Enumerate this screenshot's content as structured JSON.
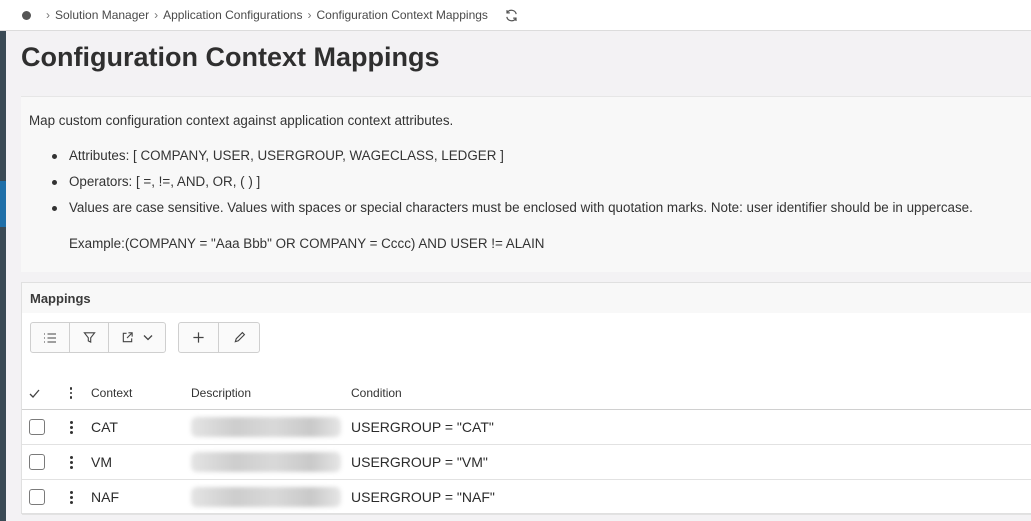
{
  "breadcrumb": {
    "items": [
      "Solution Manager",
      "Application Configurations",
      "Configuration Context Mappings"
    ]
  },
  "page": {
    "title": "Configuration Context Mappings"
  },
  "info": {
    "intro": "Map custom configuration context against application context attributes.",
    "bullets": [
      "Attributes: [ COMPANY, USER, USERGROUP, WAGECLASS, LEDGER ]",
      "Operators: [ =, !=, AND, OR, ( ) ]",
      "Values are case sensitive. Values with spaces or special characters must be enclosed with quotation marks. Note: user identifier should be in uppercase."
    ],
    "example": "Example:(COMPANY = \"Aaa Bbb\" OR COMPANY = Cccc) AND USER != ALAIN"
  },
  "mappings": {
    "title": "Mappings",
    "toolbar_icons": [
      "list-settings-icon",
      "filter-icon",
      "export-icon",
      "chevron-down-icon",
      "add-icon",
      "edit-icon"
    ],
    "columns": {
      "check": "✓",
      "context": "Context",
      "description": "Description",
      "condition": "Condition"
    },
    "rows": [
      {
        "context": "CAT",
        "description_redacted": true,
        "condition": "USERGROUP = \"CAT\""
      },
      {
        "context": "VM",
        "description_redacted": true,
        "condition": "USERGROUP = \"VM\""
      },
      {
        "context": "NAF",
        "description_redacted": true,
        "condition": "USERGROUP = \"NAF\""
      }
    ]
  },
  "colors": {
    "sidebar": "#3a4a55",
    "sidebar_accent": "#1f6fa8",
    "background": "#f3f2f4"
  }
}
